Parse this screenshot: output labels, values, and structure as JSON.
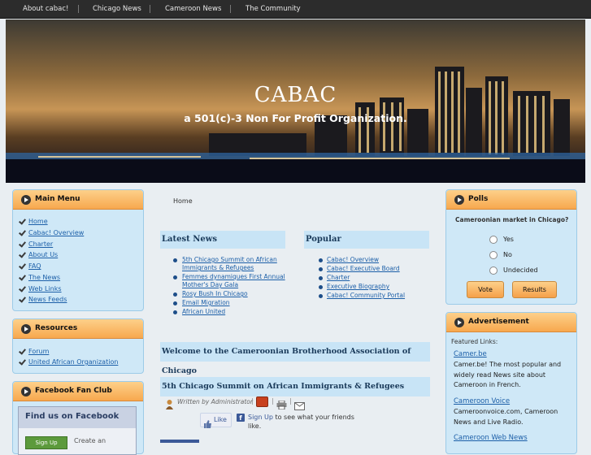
{
  "topnav": {
    "items": [
      "About cabac!",
      "Chicago News",
      "Cameroon News",
      "The Community"
    ]
  },
  "banner": {
    "title": "CABAC",
    "subtitle": "a 501(c)-3 Non For Profit Organization."
  },
  "breadcrumb": "Home",
  "main_menu": {
    "title": "Main Menu",
    "items": [
      "Home",
      "Cabac! Overview",
      "Charter",
      "About Us",
      "FAQ",
      "The News",
      "Web Links",
      "News Feeds"
    ]
  },
  "resources": {
    "title": "Resources",
    "items": [
      "Forum",
      "United African Organization"
    ]
  },
  "facebook": {
    "title": "Facebook Fan Club",
    "widget_title": "Find us on Facebook",
    "sign_up": "Sign Up",
    "create_text": "Create an"
  },
  "latest_news": {
    "title": "Latest News",
    "items": [
      "5th Chicago Summit on African Immigrants & Refugees",
      "Femmes dynamiques First Annual Mother's Day Gala",
      "Rosy Bush In Chicago",
      "Email Migration",
      "African United"
    ]
  },
  "popular": {
    "title": "Popular",
    "items": [
      "Cabac! Overview",
      "Cabac! Executive Board",
      "Charter",
      "Executive Biography",
      "Cabac! Community Portal"
    ]
  },
  "welcome": {
    "title": "Welcome to the Cameroonian Brotherhood Association of Chicago"
  },
  "article": {
    "title": "5th Chicago Summit on African Immigrants & Refugees",
    "author": "Written by Administrator",
    "like_label": "Like",
    "signup_link": "Sign Up",
    "signup_text": " to see what your friends like."
  },
  "polls": {
    "title": "Polls",
    "question": "Cameroonian market in Chicago?",
    "options": [
      "Yes",
      "No",
      "Undecided"
    ],
    "vote": "Vote",
    "results": "Results"
  },
  "advertisement": {
    "title": "Advertisement",
    "featured": "Featured Links:",
    "links": [
      {
        "name": "Camer.be",
        "desc": "Camer.be! The most popular and widely read News site about Cameroon in French."
      },
      {
        "name": "Cameroon Voice",
        "desc": "Cameroonvoice.com, Cameroon News and Live Radio."
      },
      {
        "name": "Cameroon Web News",
        "desc": ""
      }
    ]
  },
  "colors": {
    "accent": "#f7a84e",
    "panel": "#cfe8f7",
    "link": "#1c5fa8",
    "nav": "#2c2c2c"
  }
}
